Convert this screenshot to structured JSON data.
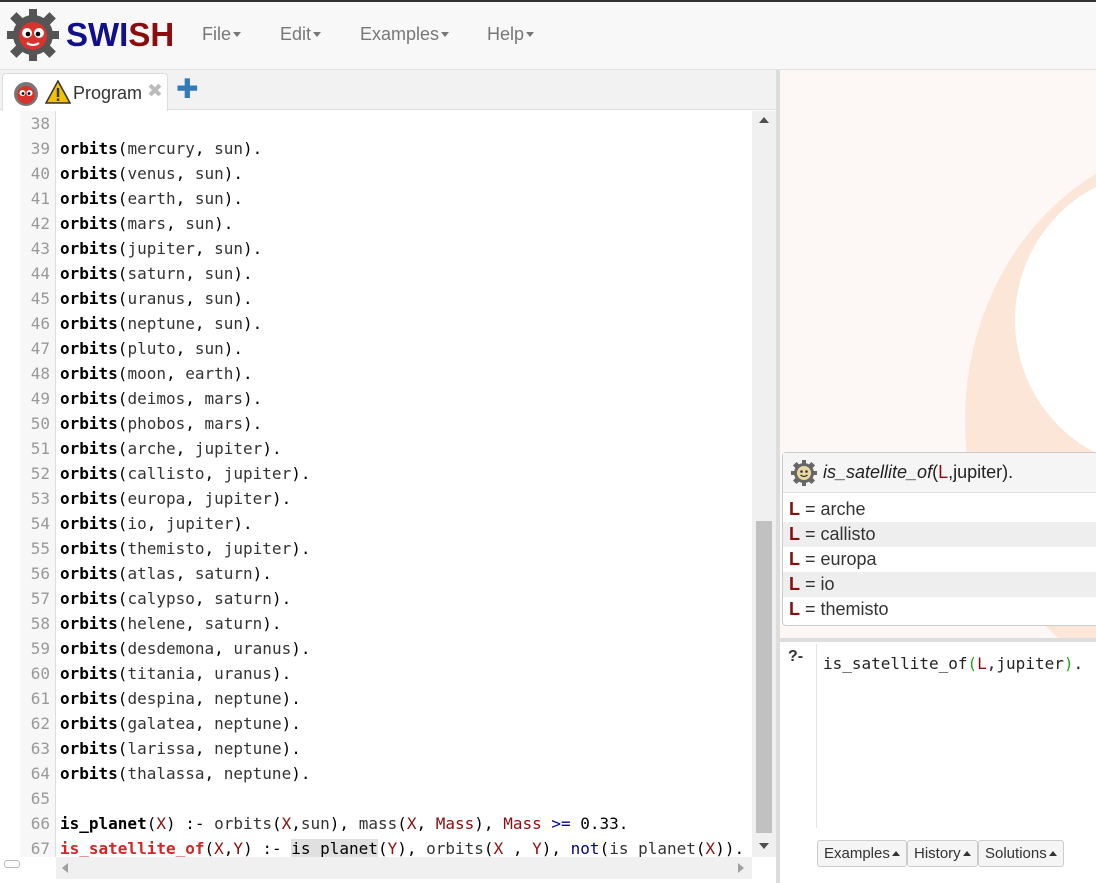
{
  "brand": {
    "part1": "SWI",
    "part2": "SH"
  },
  "menu": [
    {
      "label": "File"
    },
    {
      "label": "Edit"
    },
    {
      "label": "Examples"
    },
    {
      "label": "Help"
    }
  ],
  "tabs": [
    {
      "label": "Program",
      "close": "✖",
      "add": "✚"
    }
  ],
  "editor": {
    "lines": [
      {
        "n": "38",
        "parts": []
      },
      {
        "n": "39",
        "parts": [
          [
            "kw",
            "orbits"
          ],
          [
            "punct",
            "("
          ],
          [
            "atom",
            "mercury"
          ],
          [
            "punct",
            ", "
          ],
          [
            "atom",
            "sun"
          ],
          [
            "punct",
            ")."
          ]
        ]
      },
      {
        "n": "40",
        "parts": [
          [
            "kw",
            "orbits"
          ],
          [
            "punct",
            "("
          ],
          [
            "atom",
            "venus"
          ],
          [
            "punct",
            ", "
          ],
          [
            "atom",
            "sun"
          ],
          [
            "punct",
            ")."
          ]
        ]
      },
      {
        "n": "41",
        "parts": [
          [
            "kw",
            "orbits"
          ],
          [
            "punct",
            "("
          ],
          [
            "atom",
            "earth"
          ],
          [
            "punct",
            ", "
          ],
          [
            "atom",
            "sun"
          ],
          [
            "punct",
            ")."
          ]
        ]
      },
      {
        "n": "42",
        "parts": [
          [
            "kw",
            "orbits"
          ],
          [
            "punct",
            "("
          ],
          [
            "atom",
            "mars"
          ],
          [
            "punct",
            ", "
          ],
          [
            "atom",
            "sun"
          ],
          [
            "punct",
            ")."
          ]
        ]
      },
      {
        "n": "43",
        "parts": [
          [
            "kw",
            "orbits"
          ],
          [
            "punct",
            "("
          ],
          [
            "atom",
            "jupiter"
          ],
          [
            "punct",
            ", "
          ],
          [
            "atom",
            "sun"
          ],
          [
            "punct",
            ")."
          ]
        ]
      },
      {
        "n": "44",
        "parts": [
          [
            "kw",
            "orbits"
          ],
          [
            "punct",
            "("
          ],
          [
            "atom",
            "saturn"
          ],
          [
            "punct",
            ", "
          ],
          [
            "atom",
            "sun"
          ],
          [
            "punct",
            ")."
          ]
        ]
      },
      {
        "n": "45",
        "parts": [
          [
            "kw",
            "orbits"
          ],
          [
            "punct",
            "("
          ],
          [
            "atom",
            "uranus"
          ],
          [
            "punct",
            ", "
          ],
          [
            "atom",
            "sun"
          ],
          [
            "punct",
            ")."
          ]
        ]
      },
      {
        "n": "46",
        "parts": [
          [
            "kw",
            "orbits"
          ],
          [
            "punct",
            "("
          ],
          [
            "atom",
            "neptune"
          ],
          [
            "punct",
            ", "
          ],
          [
            "atom",
            "sun"
          ],
          [
            "punct",
            ")."
          ]
        ]
      },
      {
        "n": "47",
        "parts": [
          [
            "kw",
            "orbits"
          ],
          [
            "punct",
            "("
          ],
          [
            "atom",
            "pluto"
          ],
          [
            "punct",
            ", "
          ],
          [
            "atom",
            "sun"
          ],
          [
            "punct",
            ")."
          ]
        ]
      },
      {
        "n": "48",
        "parts": [
          [
            "kw",
            "orbits"
          ],
          [
            "punct",
            "("
          ],
          [
            "atom",
            "moon"
          ],
          [
            "punct",
            ", "
          ],
          [
            "atom",
            "earth"
          ],
          [
            "punct",
            ")."
          ]
        ]
      },
      {
        "n": "49",
        "parts": [
          [
            "kw",
            "orbits"
          ],
          [
            "punct",
            "("
          ],
          [
            "atom",
            "deimos"
          ],
          [
            "punct",
            ", "
          ],
          [
            "atom",
            "mars"
          ],
          [
            "punct",
            ")."
          ]
        ]
      },
      {
        "n": "50",
        "parts": [
          [
            "kw",
            "orbits"
          ],
          [
            "punct",
            "("
          ],
          [
            "atom",
            "phobos"
          ],
          [
            "punct",
            ", "
          ],
          [
            "atom",
            "mars"
          ],
          [
            "punct",
            ")."
          ]
        ]
      },
      {
        "n": "51",
        "parts": [
          [
            "kw",
            "orbits"
          ],
          [
            "punct",
            "("
          ],
          [
            "atom",
            "arche"
          ],
          [
            "punct",
            ", "
          ],
          [
            "atom",
            "jupiter"
          ],
          [
            "punct",
            ")."
          ]
        ]
      },
      {
        "n": "52",
        "parts": [
          [
            "kw",
            "orbits"
          ],
          [
            "punct",
            "("
          ],
          [
            "atom",
            "callisto"
          ],
          [
            "punct",
            ", "
          ],
          [
            "atom",
            "jupiter"
          ],
          [
            "punct",
            ")."
          ]
        ]
      },
      {
        "n": "53",
        "parts": [
          [
            "kw",
            "orbits"
          ],
          [
            "punct",
            "("
          ],
          [
            "atom",
            "europa"
          ],
          [
            "punct",
            ", "
          ],
          [
            "atom",
            "jupiter"
          ],
          [
            "punct",
            ")."
          ]
        ]
      },
      {
        "n": "54",
        "parts": [
          [
            "kw",
            "orbits"
          ],
          [
            "punct",
            "("
          ],
          [
            "atom",
            "io"
          ],
          [
            "punct",
            ", "
          ],
          [
            "atom",
            "jupiter"
          ],
          [
            "punct",
            ")."
          ]
        ]
      },
      {
        "n": "55",
        "parts": [
          [
            "kw",
            "orbits"
          ],
          [
            "punct",
            "("
          ],
          [
            "atom",
            "themisto"
          ],
          [
            "punct",
            ", "
          ],
          [
            "atom",
            "jupiter"
          ],
          [
            "punct",
            ")."
          ]
        ]
      },
      {
        "n": "56",
        "parts": [
          [
            "kw",
            "orbits"
          ],
          [
            "punct",
            "("
          ],
          [
            "atom",
            "atlas"
          ],
          [
            "punct",
            ", "
          ],
          [
            "atom",
            "saturn"
          ],
          [
            "punct",
            ")."
          ]
        ]
      },
      {
        "n": "57",
        "parts": [
          [
            "kw",
            "orbits"
          ],
          [
            "punct",
            "("
          ],
          [
            "atom",
            "calypso"
          ],
          [
            "punct",
            ", "
          ],
          [
            "atom",
            "saturn"
          ],
          [
            "punct",
            ")."
          ]
        ]
      },
      {
        "n": "58",
        "parts": [
          [
            "kw",
            "orbits"
          ],
          [
            "punct",
            "("
          ],
          [
            "atom",
            "helene"
          ],
          [
            "punct",
            ", "
          ],
          [
            "atom",
            "saturn"
          ],
          [
            "punct",
            ")."
          ]
        ]
      },
      {
        "n": "59",
        "parts": [
          [
            "kw",
            "orbits"
          ],
          [
            "punct",
            "("
          ],
          [
            "atom",
            "desdemona"
          ],
          [
            "punct",
            ", "
          ],
          [
            "atom",
            "uranus"
          ],
          [
            "punct",
            ")."
          ]
        ]
      },
      {
        "n": "60",
        "parts": [
          [
            "kw",
            "orbits"
          ],
          [
            "punct",
            "("
          ],
          [
            "atom",
            "titania"
          ],
          [
            "punct",
            ", "
          ],
          [
            "atom",
            "uranus"
          ],
          [
            "punct",
            ")."
          ]
        ]
      },
      {
        "n": "61",
        "parts": [
          [
            "kw",
            "orbits"
          ],
          [
            "punct",
            "("
          ],
          [
            "atom",
            "despina"
          ],
          [
            "punct",
            ", "
          ],
          [
            "atom",
            "neptune"
          ],
          [
            "punct",
            ")."
          ]
        ]
      },
      {
        "n": "62",
        "parts": [
          [
            "kw",
            "orbits"
          ],
          [
            "punct",
            "("
          ],
          [
            "atom",
            "galatea"
          ],
          [
            "punct",
            ", "
          ],
          [
            "atom",
            "neptune"
          ],
          [
            "punct",
            ")."
          ]
        ]
      },
      {
        "n": "63",
        "parts": [
          [
            "kw",
            "orbits"
          ],
          [
            "punct",
            "("
          ],
          [
            "atom",
            "larissa"
          ],
          [
            "punct",
            ", "
          ],
          [
            "atom",
            "neptune"
          ],
          [
            "punct",
            ")."
          ]
        ]
      },
      {
        "n": "64",
        "parts": [
          [
            "kw",
            "orbits"
          ],
          [
            "punct",
            "("
          ],
          [
            "atom",
            "thalassa"
          ],
          [
            "punct",
            ", "
          ],
          [
            "atom",
            "neptune"
          ],
          [
            "punct",
            ")."
          ]
        ]
      },
      {
        "n": "65",
        "parts": []
      },
      {
        "n": "66",
        "parts": [
          [
            "kw",
            "is_planet"
          ],
          [
            "punct",
            "("
          ],
          [
            "var",
            "X"
          ],
          [
            "punct",
            ") :- "
          ],
          [
            "atom",
            "orbits"
          ],
          [
            "punct",
            "("
          ],
          [
            "var",
            "X"
          ],
          [
            "punct",
            ","
          ],
          [
            "atom",
            "sun"
          ],
          [
            "punct",
            "), "
          ],
          [
            "atom",
            "mass"
          ],
          [
            "punct",
            "("
          ],
          [
            "var",
            "X"
          ],
          [
            "punct",
            ", "
          ],
          [
            "var",
            "Mass"
          ],
          [
            "punct",
            "), "
          ],
          [
            "var",
            "Mass"
          ],
          [
            "punct",
            " "
          ],
          [
            "op",
            ">="
          ],
          [
            "punct",
            " 0.33."
          ]
        ]
      },
      {
        "n": "67",
        "parts": [
          [
            "head",
            "is_satellite_of"
          ],
          [
            "punct",
            "("
          ],
          [
            "var",
            "X"
          ],
          [
            "punct",
            ","
          ],
          [
            "var",
            "Y"
          ],
          [
            "punct",
            ") :- "
          ],
          [
            "hl",
            "is_planet"
          ],
          [
            "punct",
            "("
          ],
          [
            "var",
            "Y"
          ],
          [
            "punct",
            "), "
          ],
          [
            "atom",
            "orbits"
          ],
          [
            "punct",
            "("
          ],
          [
            "var",
            "X"
          ],
          [
            "punct",
            " , "
          ],
          [
            "var",
            "Y"
          ],
          [
            "punct",
            "), "
          ],
          [
            "op",
            "not"
          ],
          [
            "punct",
            "("
          ],
          [
            "atom",
            "is_planet"
          ],
          [
            "punct",
            "("
          ],
          [
            "var",
            "X"
          ],
          [
            "punct",
            ")). "
          ]
        ]
      }
    ]
  },
  "answer": {
    "query_pred": "is_satellite_of",
    "query_open": "(",
    "query_var": "L",
    "query_rest": ",jupiter).",
    "rows": [
      {
        "var": "L",
        "eq": " = ",
        "value": "arche"
      },
      {
        "var": "L",
        "eq": " = ",
        "value": "callisto"
      },
      {
        "var": "L",
        "eq": " = ",
        "value": "europa"
      },
      {
        "var": "L",
        "eq": " = ",
        "value": "io"
      },
      {
        "var": "L",
        "eq": " = ",
        "value": "themisto"
      }
    ]
  },
  "query": {
    "prompt": "?-",
    "pred": "is_satellite_of",
    "open": "(",
    "var": "L",
    "rest": ",jupiter",
    "close": ")",
    "end": "."
  },
  "query_buttons": [
    {
      "label": "Examples"
    },
    {
      "label": "History"
    },
    {
      "label": "Solutions"
    }
  ],
  "colors": {
    "brand_blue": "#10108a",
    "brand_red": "#8b0d0d",
    "head_red": "#d12727",
    "link_blue": "#337ab7"
  }
}
